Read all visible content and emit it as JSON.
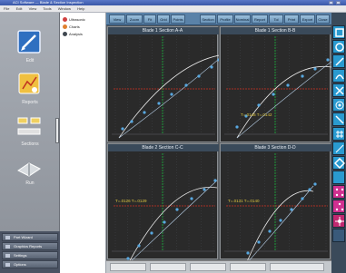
{
  "window": {
    "title": "ACI Software — Blade & Section Inspection"
  },
  "menu": [
    "File",
    "Edit",
    "View",
    "Tools",
    "Window",
    "Help"
  ],
  "left_panel": {
    "items": [
      {
        "label": "Edit"
      },
      {
        "label": "Reports"
      },
      {
        "label": "Sections"
      },
      {
        "label": "Run"
      }
    ],
    "bottom": [
      "Part Wizard",
      "Graphics Reports",
      "Settings",
      "Options"
    ]
  },
  "tree": {
    "items": [
      "Ultrasonic",
      "Charts",
      "Analysis"
    ]
  },
  "toolbar": {
    "buttons": [
      "View",
      "Zoom",
      "Fit",
      "Grid",
      "Points",
      "Section",
      "Profile",
      "Nominal",
      "Report",
      "Tol",
      "Print",
      "Export",
      "Close"
    ]
  },
  "panels": [
    {
      "title": "Blade 1 Section A-A",
      "note": ""
    },
    {
      "title": "Blade 1 Section B-B",
      "note": "T=.0145  T=.0142"
    },
    {
      "title": "Blade 2 Section C-C",
      "note": "T=.0126  T=.0129"
    },
    {
      "title": "Blade 3 Section D-D",
      "note": "T=.0131  T=.0140"
    }
  ],
  "status": {
    "cells": [
      "",
      "",
      "",
      "",
      ""
    ]
  },
  "colors": {
    "toolbar": "#5a82a8",
    "panel_bg": "#2a2a2a",
    "nominal_curve": "#e8e8e8",
    "measured_points": "#58a8e0",
    "tol_line": "#d03020",
    "grid_line": "#1e9a3a"
  }
}
